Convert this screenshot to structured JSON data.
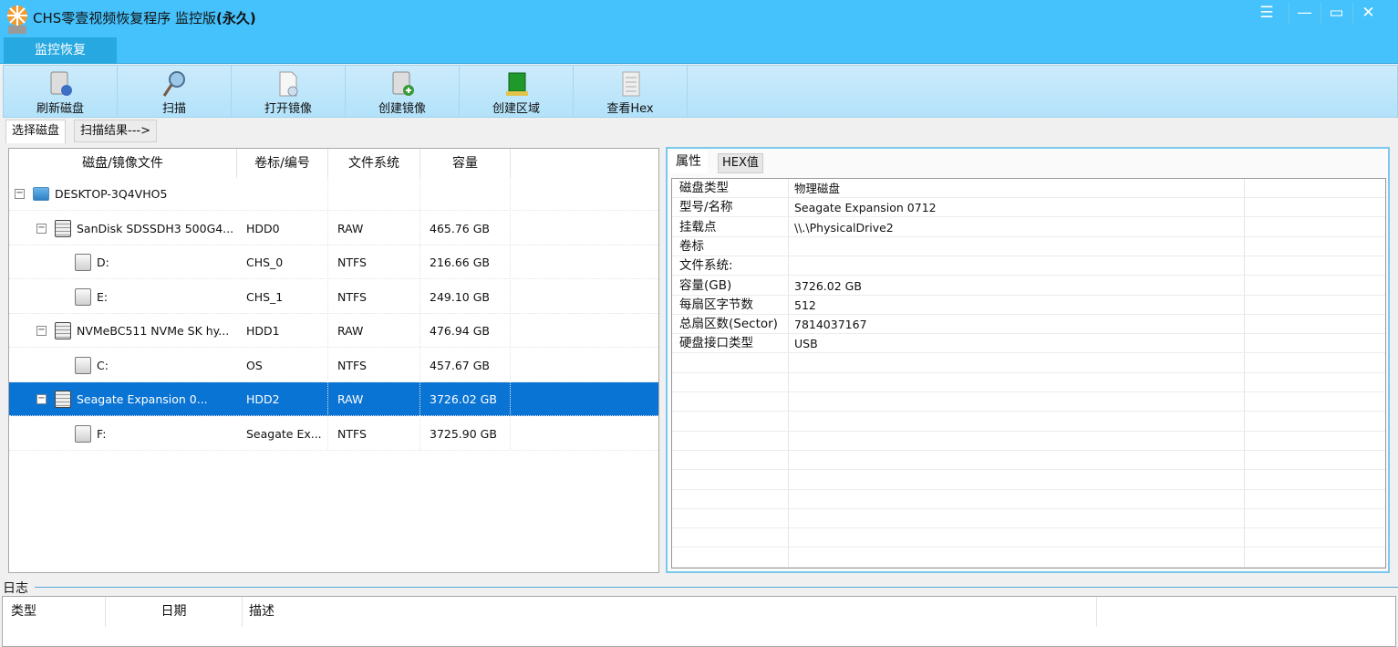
{
  "window": {
    "title_prefix": "CHS零壹视频恢复程序 监控版",
    "title_suffix": "(永久)",
    "menu_tab": "监控恢复",
    "controls": {
      "menu": "☰",
      "minimize": "—",
      "maximize": "▭",
      "close": "✕"
    }
  },
  "toolbar": [
    {
      "label": "刷新磁盘",
      "icon": "refresh-disk-icon"
    },
    {
      "label": "扫描",
      "icon": "magnifier-icon"
    },
    {
      "label": "打开镜像",
      "icon": "open-image-icon"
    },
    {
      "label": "创建镜像",
      "icon": "create-image-icon"
    },
    {
      "label": "创建区域",
      "icon": "create-region-icon"
    },
    {
      "label": "查看Hex",
      "icon": "hex-view-icon"
    }
  ],
  "tabs": {
    "select_disk": "选择磁盘",
    "scan_result": "扫描结果--->"
  },
  "disk_table": {
    "columns": [
      "磁盘/镜像文件",
      "卷标/编号",
      "文件系统",
      "容量"
    ],
    "rows": [
      {
        "level": 0,
        "type": "pc",
        "name": "DESKTOP-3Q4VHO5",
        "label": "",
        "fs": "",
        "size": ""
      },
      {
        "level": 1,
        "type": "hdd",
        "name": "SanDisk SDSSDH3 500G4...",
        "label": "HDD0",
        "fs": "RAW",
        "size": "465.76 GB"
      },
      {
        "level": 2,
        "type": "vol",
        "name": "D:",
        "label": "CHS_0",
        "fs": "NTFS",
        "size": "216.66 GB"
      },
      {
        "level": 2,
        "type": "vol",
        "name": "E:",
        "label": "CHS_1",
        "fs": "NTFS",
        "size": "249.10 GB"
      },
      {
        "level": 1,
        "type": "hdd",
        "name": "NVMeBC511 NVMe SK hy...",
        "label": "HDD1",
        "fs": "RAW",
        "size": "476.94 GB"
      },
      {
        "level": 2,
        "type": "vol",
        "name": "C:",
        "label": "OS",
        "fs": "NTFS",
        "size": "457.67 GB"
      },
      {
        "level": 1,
        "type": "hdd",
        "name": "Seagate Expansion      0...",
        "label": "HDD2",
        "fs": "RAW",
        "size": "3726.02 GB",
        "selected": true
      },
      {
        "level": 2,
        "type": "vol",
        "name": "F:",
        "label": "Seagate Ex...",
        "fs": "NTFS",
        "size": "3725.90 GB"
      }
    ]
  },
  "properties": {
    "tabs": [
      "属性",
      "HEX值"
    ],
    "rows": [
      {
        "k": "磁盘类型",
        "v": "物理磁盘"
      },
      {
        "k": "型号/名称",
        "v": "Seagate Expansion      0712"
      },
      {
        "k": "挂载点",
        "v": "\\\\.\\PhysicalDrive2"
      },
      {
        "k": "卷标",
        "v": ""
      },
      {
        "k": "文件系统:",
        "v": ""
      },
      {
        "k": "容量(GB)",
        "v": "3726.02 GB"
      },
      {
        "k": "每扇区字节数",
        "v": "512"
      },
      {
        "k": "总扇区数(Sector)",
        "v": "7814037167"
      },
      {
        "k": "硬盘接口类型",
        "v": "USB"
      }
    ]
  },
  "log": {
    "label": "日志",
    "columns": [
      "类型",
      "日期",
      "描述"
    ]
  },
  "colors": {
    "titlebar": "#45c1fb",
    "menu_tab": "#27a8e0",
    "selection": "#0a74d4"
  }
}
